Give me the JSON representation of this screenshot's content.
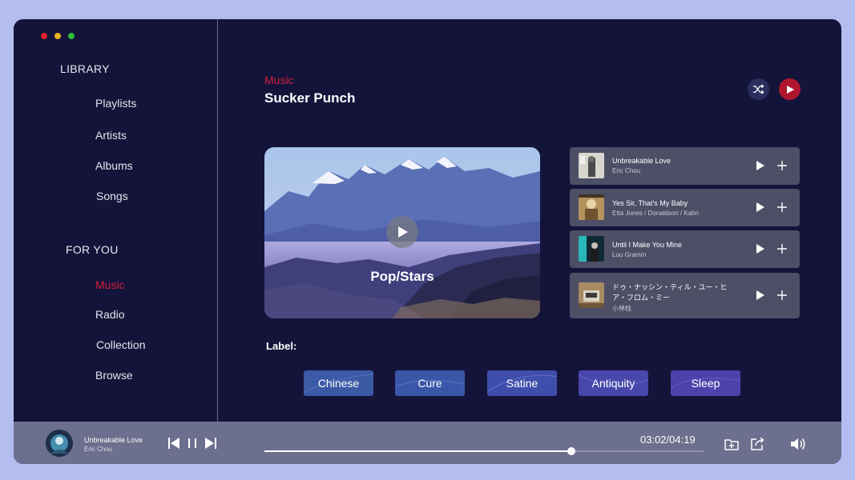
{
  "window": {
    "traffic_colors": [
      "#e0252c",
      "#e9b21a",
      "#2fbf3c"
    ]
  },
  "sidebar": {
    "library_title": "LIBRARY",
    "library_items": [
      {
        "label": "Playlists"
      },
      {
        "label": "Artists"
      },
      {
        "label": "Albums"
      },
      {
        "label": "Songs"
      }
    ],
    "foryou_title": "FOR YOU",
    "foryou_items": [
      {
        "label": "Music",
        "active": true
      },
      {
        "label": "Radio",
        "active": false
      },
      {
        "label": "Collection",
        "active": false
      },
      {
        "label": "Browse",
        "active": false
      }
    ]
  },
  "header": {
    "category": "Music",
    "title": "Sucker Punch",
    "shuffle_icon": "shuffle-icon",
    "play_icon": "play-icon"
  },
  "featured": {
    "label": "Pop/Stars",
    "play_icon": "play-icon"
  },
  "tracks": [
    {
      "name": "Unbreakable Love",
      "artist": "Eric Chou"
    },
    {
      "name": "Yes Sir, That's My Baby",
      "artist": "Etta Jones / Donaldson / Kahn"
    },
    {
      "name": "Until I Make You Mine",
      "artist": "Lou Gramm"
    },
    {
      "name": "ドゥ・ナッシン・ティル・ユー・ヒア・フロム・ミー",
      "artist": "小林桂"
    }
  ],
  "labels": {
    "title": "Label:",
    "tags": [
      "Chinese",
      "Cure",
      "Satine",
      "Antiquity",
      "Sleep"
    ]
  },
  "player": {
    "track_name": "Unbreakable Love",
    "artist": "Eric Chou",
    "time": "03:02/04:19",
    "progress_fraction": 0.6988,
    "icons": [
      "skip-back-icon",
      "pause-icon",
      "skip-forward-icon",
      "add-to-folder-icon",
      "share-icon",
      "volume-icon"
    ]
  },
  "colors": {
    "accent": "#d2203a",
    "background": "#14143a",
    "page": "#b3bdf0",
    "track_card": "#4d4f66",
    "player_bar": "#6d6f8e"
  }
}
